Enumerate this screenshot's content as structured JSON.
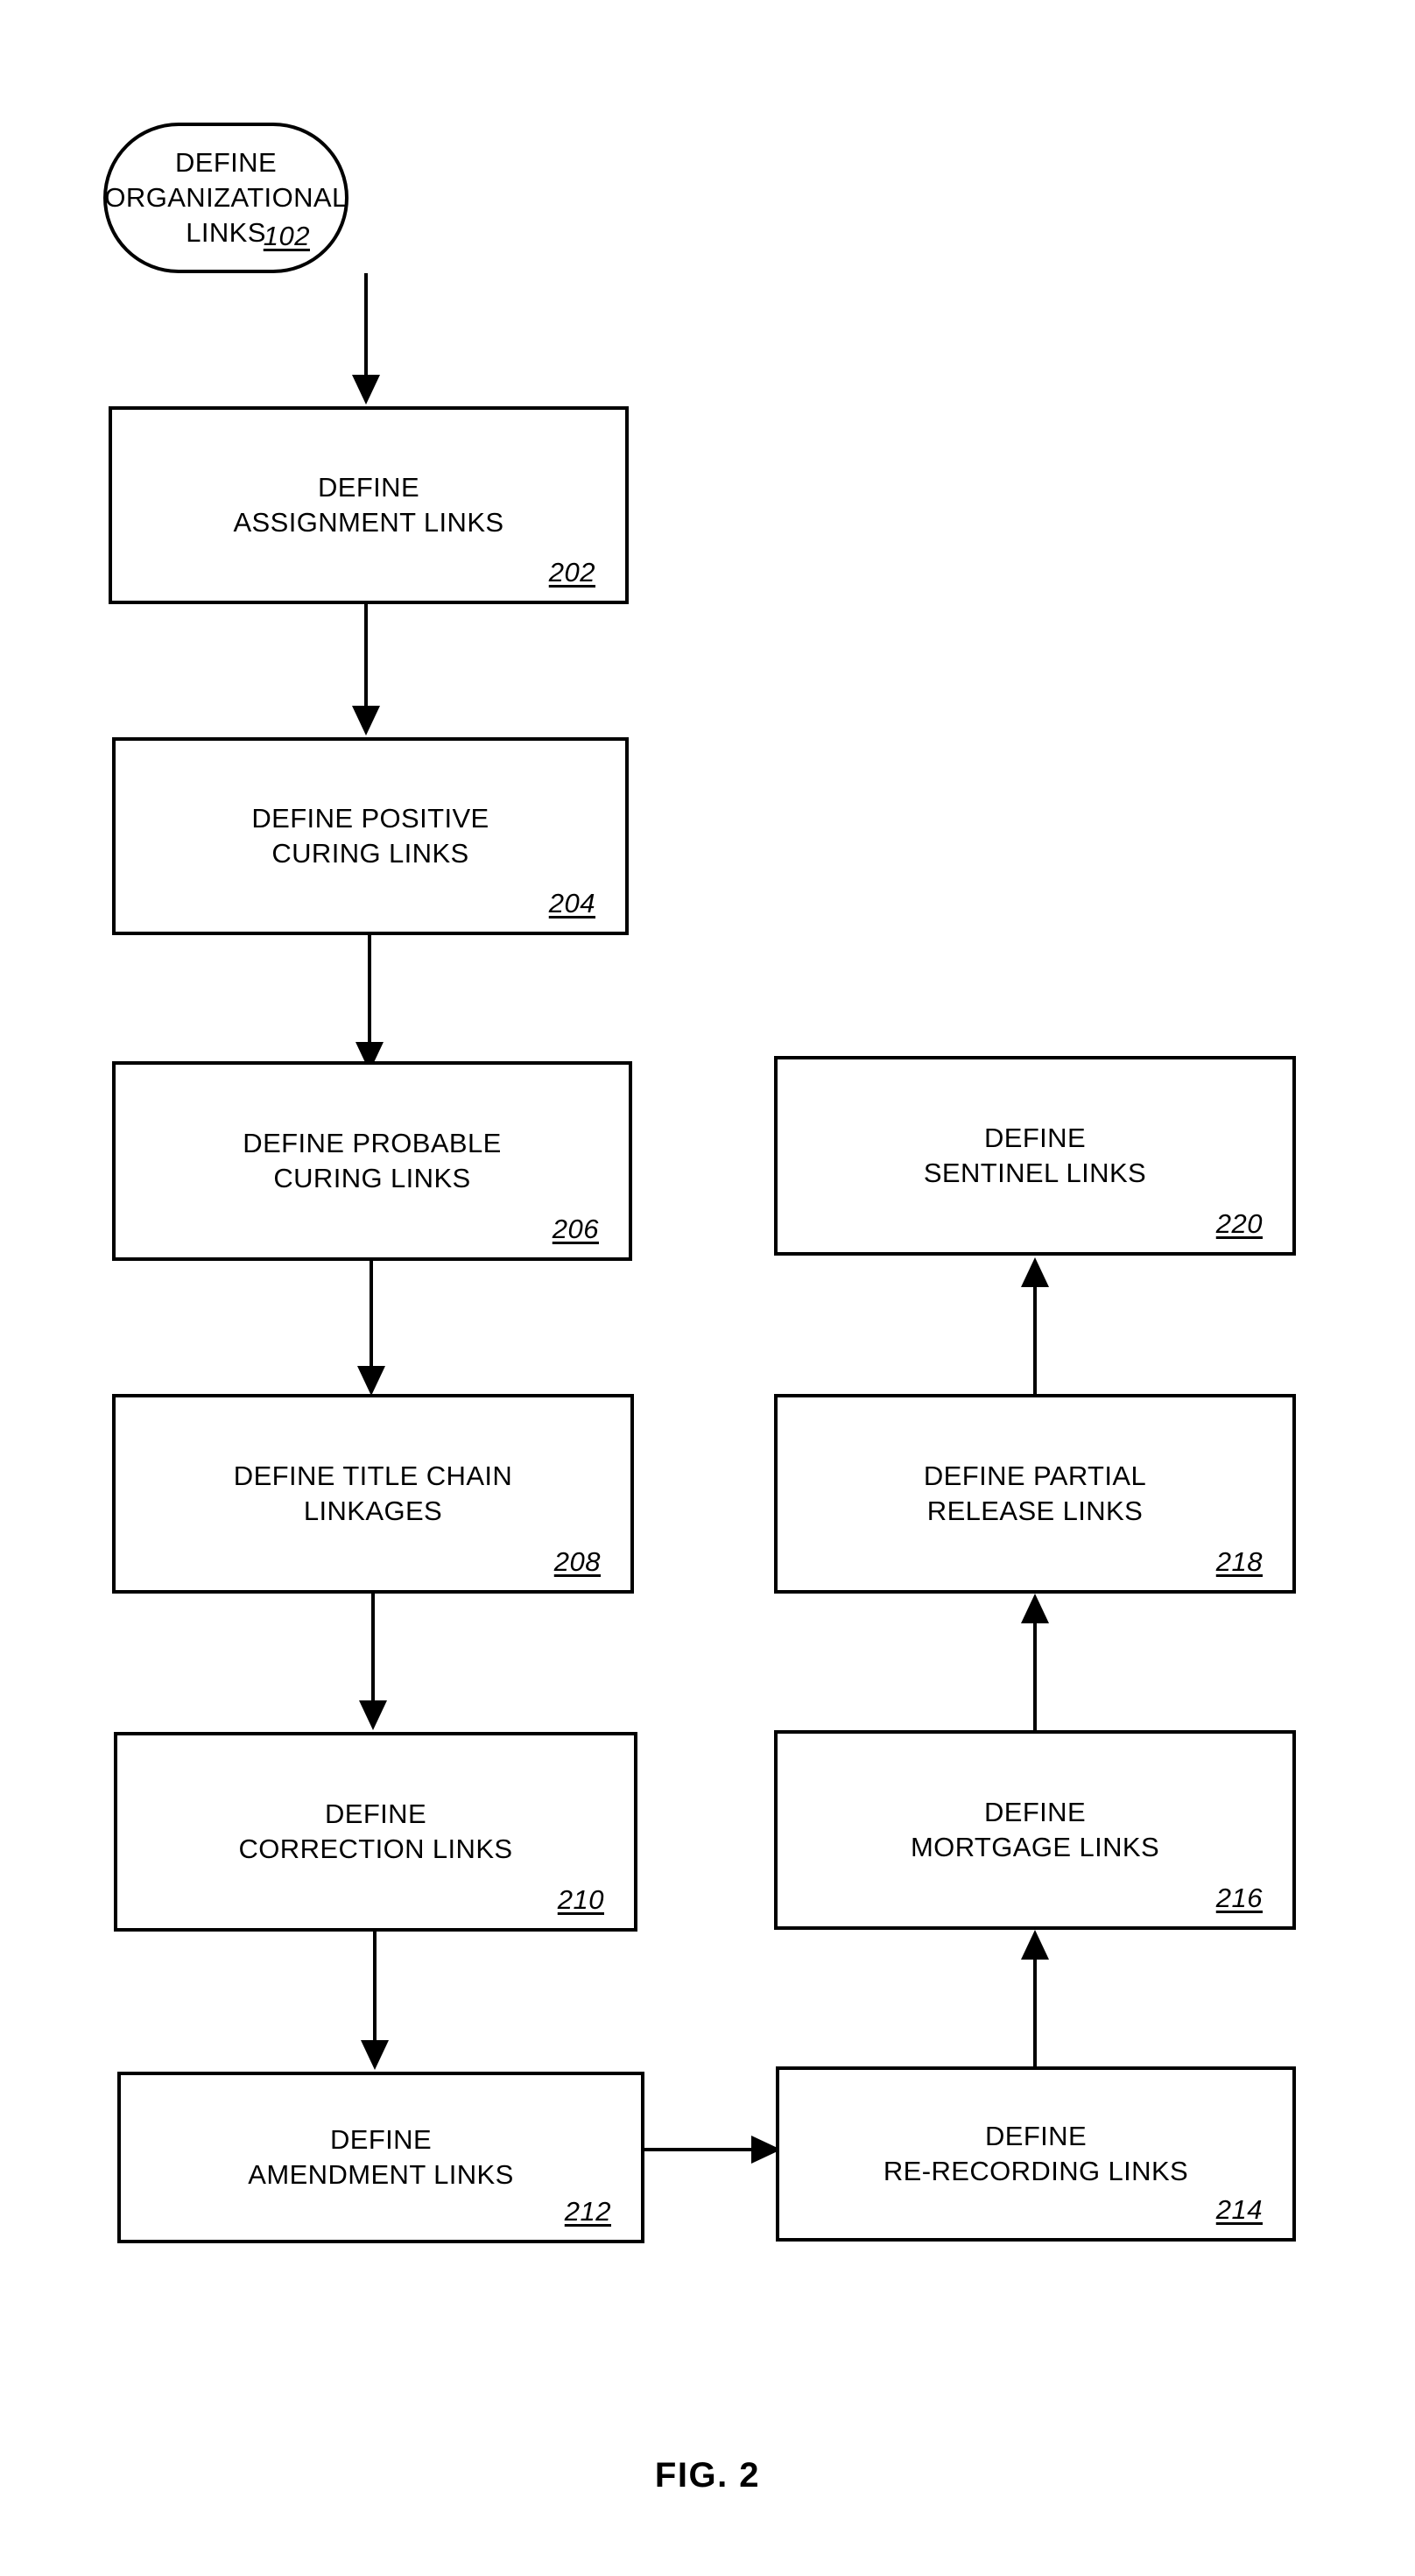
{
  "figure": {
    "caption": "FIG. 2"
  },
  "nodes": [
    {
      "id": "organizational-links",
      "shape": "terminal",
      "label": "DEFINE ORGANIZATIONAL\nLINKS",
      "ref": "102"
    },
    {
      "id": "assignment-links",
      "shape": "rect",
      "label": "DEFINE\nASSIGNMENT LINKS",
      "ref": "202"
    },
    {
      "id": "positive-curing-links",
      "shape": "rect",
      "label": "DEFINE POSITIVE\nCURING LINKS",
      "ref": "204"
    },
    {
      "id": "probable-curing-links",
      "shape": "rect",
      "label": "DEFINE PROBABLE\nCURING LINKS",
      "ref": "206"
    },
    {
      "id": "title-chain-linkages",
      "shape": "rect",
      "label": "DEFINE TITLE CHAIN\nLINKAGES",
      "ref": "208"
    },
    {
      "id": "correction-links",
      "shape": "rect",
      "label": "DEFINE\nCORRECTION LINKS",
      "ref": "210"
    },
    {
      "id": "amendment-links",
      "shape": "rect",
      "label": "DEFINE\nAMENDMENT LINKS",
      "ref": "212"
    },
    {
      "id": "re-recording-links",
      "shape": "rect",
      "label": "DEFINE\nRE-RECORDING LINKS",
      "ref": "214"
    },
    {
      "id": "mortgage-links",
      "shape": "rect",
      "label": "DEFINE\nMORTGAGE LINKS",
      "ref": "216"
    },
    {
      "id": "partial-release-links",
      "shape": "rect",
      "label": "DEFINE PARTIAL\nRELEASE LINKS",
      "ref": "218"
    },
    {
      "id": "sentinel-links",
      "shape": "rect",
      "label": "DEFINE\nSENTINEL LINKS",
      "ref": "220"
    }
  ],
  "connectors": [
    {
      "from": "102",
      "to": "202",
      "direction": "down"
    },
    {
      "from": "202",
      "to": "204",
      "direction": "down"
    },
    {
      "from": "204",
      "to": "206",
      "direction": "down"
    },
    {
      "from": "206",
      "to": "208",
      "direction": "down"
    },
    {
      "from": "208",
      "to": "210",
      "direction": "down"
    },
    {
      "from": "210",
      "to": "212",
      "direction": "down"
    },
    {
      "from": "212",
      "to": "214",
      "direction": "right"
    },
    {
      "from": "214",
      "to": "216",
      "direction": "up"
    },
    {
      "from": "216",
      "to": "218",
      "direction": "up"
    },
    {
      "from": "218",
      "to": "220",
      "direction": "up"
    }
  ]
}
